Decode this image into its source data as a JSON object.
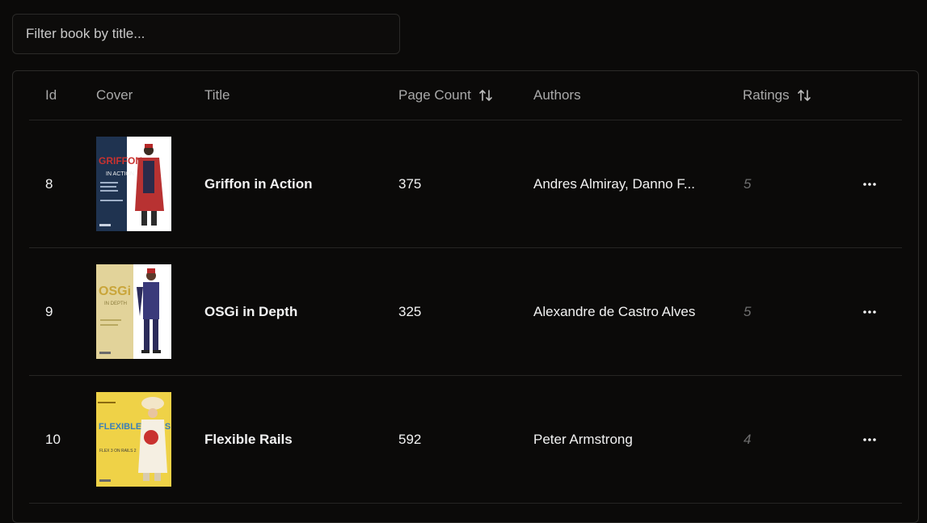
{
  "filter": {
    "placeholder": "Filter book by title..."
  },
  "columns": {
    "id": "Id",
    "cover": "Cover",
    "title": "Title",
    "page_count": "Page Count",
    "authors": "Authors",
    "ratings": "Ratings"
  },
  "rows": [
    {
      "id": "8",
      "title": "Griffon in Action",
      "page_count": "375",
      "authors": "Andres Almiray, Danno F...",
      "rating": "5",
      "cover_text_main": "GRIFFON",
      "cover_text_sub": "IN ACTION",
      "cover_bg": "#1f3350",
      "cover_accent": "#c9322f"
    },
    {
      "id": "9",
      "title": "OSGi in Depth",
      "page_count": "325",
      "authors": "Alexandre de Castro Alves",
      "rating": "5",
      "cover_text_main": "OSGi",
      "cover_text_sub": "IN DEPTH",
      "cover_bg": "#e2d39a",
      "cover_accent": "#3a3a7a"
    },
    {
      "id": "10",
      "title": "Flexible Rails",
      "page_count": "592",
      "authors": "Peter Armstrong",
      "rating": "4",
      "cover_text_main": "FLEXIBLE RAILS",
      "cover_text_sub": "FLEX 3 ON RAILS 2",
      "cover_bg": "#efd247",
      "cover_accent": "#2f6fae"
    }
  ]
}
